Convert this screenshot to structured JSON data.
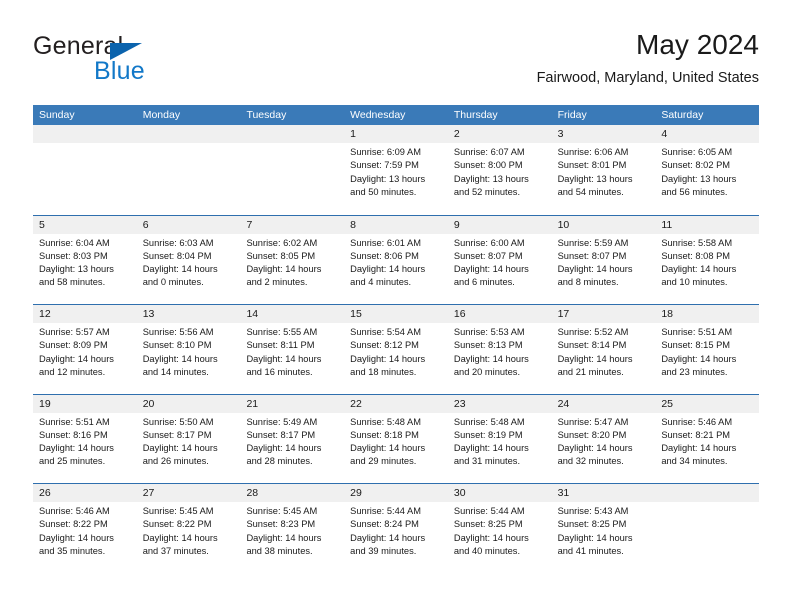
{
  "brand": {
    "word_top": "General",
    "word_bottom": "Blue",
    "triangle_icon": "brand-triangle-icon",
    "color_dark": "#231f20",
    "color_blue": "#1278c8"
  },
  "header": {
    "title": "May 2024",
    "subtitle": "Fairwood, Maryland, United States"
  },
  "theme": {
    "header_blue": "#3a7ab8",
    "row_divider_blue": "#2f6fae",
    "day_band_gray": "#f0f0f0",
    "text": "#1a1a1a"
  },
  "calendar": {
    "weekdays": [
      "Sunday",
      "Monday",
      "Tuesday",
      "Wednesday",
      "Thursday",
      "Friday",
      "Saturday"
    ],
    "weeks": [
      [
        {
          "day": "",
          "sunrise": "",
          "sunset": "",
          "daylight_line1": "",
          "daylight_line2": ""
        },
        {
          "day": "",
          "sunrise": "",
          "sunset": "",
          "daylight_line1": "",
          "daylight_line2": ""
        },
        {
          "day": "",
          "sunrise": "",
          "sunset": "",
          "daylight_line1": "",
          "daylight_line2": ""
        },
        {
          "day": "1",
          "sunrise": "Sunrise: 6:09 AM",
          "sunset": "Sunset: 7:59 PM",
          "daylight_line1": "Daylight: 13 hours",
          "daylight_line2": "and 50 minutes."
        },
        {
          "day": "2",
          "sunrise": "Sunrise: 6:07 AM",
          "sunset": "Sunset: 8:00 PM",
          "daylight_line1": "Daylight: 13 hours",
          "daylight_line2": "and 52 minutes."
        },
        {
          "day": "3",
          "sunrise": "Sunrise: 6:06 AM",
          "sunset": "Sunset: 8:01 PM",
          "daylight_line1": "Daylight: 13 hours",
          "daylight_line2": "and 54 minutes."
        },
        {
          "day": "4",
          "sunrise": "Sunrise: 6:05 AM",
          "sunset": "Sunset: 8:02 PM",
          "daylight_line1": "Daylight: 13 hours",
          "daylight_line2": "and 56 minutes."
        }
      ],
      [
        {
          "day": "5",
          "sunrise": "Sunrise: 6:04 AM",
          "sunset": "Sunset: 8:03 PM",
          "daylight_line1": "Daylight: 13 hours",
          "daylight_line2": "and 58 minutes."
        },
        {
          "day": "6",
          "sunrise": "Sunrise: 6:03 AM",
          "sunset": "Sunset: 8:04 PM",
          "daylight_line1": "Daylight: 14 hours",
          "daylight_line2": "and 0 minutes."
        },
        {
          "day": "7",
          "sunrise": "Sunrise: 6:02 AM",
          "sunset": "Sunset: 8:05 PM",
          "daylight_line1": "Daylight: 14 hours",
          "daylight_line2": "and 2 minutes."
        },
        {
          "day": "8",
          "sunrise": "Sunrise: 6:01 AM",
          "sunset": "Sunset: 8:06 PM",
          "daylight_line1": "Daylight: 14 hours",
          "daylight_line2": "and 4 minutes."
        },
        {
          "day": "9",
          "sunrise": "Sunrise: 6:00 AM",
          "sunset": "Sunset: 8:07 PM",
          "daylight_line1": "Daylight: 14 hours",
          "daylight_line2": "and 6 minutes."
        },
        {
          "day": "10",
          "sunrise": "Sunrise: 5:59 AM",
          "sunset": "Sunset: 8:07 PM",
          "daylight_line1": "Daylight: 14 hours",
          "daylight_line2": "and 8 minutes."
        },
        {
          "day": "11",
          "sunrise": "Sunrise: 5:58 AM",
          "sunset": "Sunset: 8:08 PM",
          "daylight_line1": "Daylight: 14 hours",
          "daylight_line2": "and 10 minutes."
        }
      ],
      [
        {
          "day": "12",
          "sunrise": "Sunrise: 5:57 AM",
          "sunset": "Sunset: 8:09 PM",
          "daylight_line1": "Daylight: 14 hours",
          "daylight_line2": "and 12 minutes."
        },
        {
          "day": "13",
          "sunrise": "Sunrise: 5:56 AM",
          "sunset": "Sunset: 8:10 PM",
          "daylight_line1": "Daylight: 14 hours",
          "daylight_line2": "and 14 minutes."
        },
        {
          "day": "14",
          "sunrise": "Sunrise: 5:55 AM",
          "sunset": "Sunset: 8:11 PM",
          "daylight_line1": "Daylight: 14 hours",
          "daylight_line2": "and 16 minutes."
        },
        {
          "day": "15",
          "sunrise": "Sunrise: 5:54 AM",
          "sunset": "Sunset: 8:12 PM",
          "daylight_line1": "Daylight: 14 hours",
          "daylight_line2": "and 18 minutes."
        },
        {
          "day": "16",
          "sunrise": "Sunrise: 5:53 AM",
          "sunset": "Sunset: 8:13 PM",
          "daylight_line1": "Daylight: 14 hours",
          "daylight_line2": "and 20 minutes."
        },
        {
          "day": "17",
          "sunrise": "Sunrise: 5:52 AM",
          "sunset": "Sunset: 8:14 PM",
          "daylight_line1": "Daylight: 14 hours",
          "daylight_line2": "and 21 minutes."
        },
        {
          "day": "18",
          "sunrise": "Sunrise: 5:51 AM",
          "sunset": "Sunset: 8:15 PM",
          "daylight_line1": "Daylight: 14 hours",
          "daylight_line2": "and 23 minutes."
        }
      ],
      [
        {
          "day": "19",
          "sunrise": "Sunrise: 5:51 AM",
          "sunset": "Sunset: 8:16 PM",
          "daylight_line1": "Daylight: 14 hours",
          "daylight_line2": "and 25 minutes."
        },
        {
          "day": "20",
          "sunrise": "Sunrise: 5:50 AM",
          "sunset": "Sunset: 8:17 PM",
          "daylight_line1": "Daylight: 14 hours",
          "daylight_line2": "and 26 minutes."
        },
        {
          "day": "21",
          "sunrise": "Sunrise: 5:49 AM",
          "sunset": "Sunset: 8:17 PM",
          "daylight_line1": "Daylight: 14 hours",
          "daylight_line2": "and 28 minutes."
        },
        {
          "day": "22",
          "sunrise": "Sunrise: 5:48 AM",
          "sunset": "Sunset: 8:18 PM",
          "daylight_line1": "Daylight: 14 hours",
          "daylight_line2": "and 29 minutes."
        },
        {
          "day": "23",
          "sunrise": "Sunrise: 5:48 AM",
          "sunset": "Sunset: 8:19 PM",
          "daylight_line1": "Daylight: 14 hours",
          "daylight_line2": "and 31 minutes."
        },
        {
          "day": "24",
          "sunrise": "Sunrise: 5:47 AM",
          "sunset": "Sunset: 8:20 PM",
          "daylight_line1": "Daylight: 14 hours",
          "daylight_line2": "and 32 minutes."
        },
        {
          "day": "25",
          "sunrise": "Sunrise: 5:46 AM",
          "sunset": "Sunset: 8:21 PM",
          "daylight_line1": "Daylight: 14 hours",
          "daylight_line2": "and 34 minutes."
        }
      ],
      [
        {
          "day": "26",
          "sunrise": "Sunrise: 5:46 AM",
          "sunset": "Sunset: 8:22 PM",
          "daylight_line1": "Daylight: 14 hours",
          "daylight_line2": "and 35 minutes."
        },
        {
          "day": "27",
          "sunrise": "Sunrise: 5:45 AM",
          "sunset": "Sunset: 8:22 PM",
          "daylight_line1": "Daylight: 14 hours",
          "daylight_line2": "and 37 minutes."
        },
        {
          "day": "28",
          "sunrise": "Sunrise: 5:45 AM",
          "sunset": "Sunset: 8:23 PM",
          "daylight_line1": "Daylight: 14 hours",
          "daylight_line2": "and 38 minutes."
        },
        {
          "day": "29",
          "sunrise": "Sunrise: 5:44 AM",
          "sunset": "Sunset: 8:24 PM",
          "daylight_line1": "Daylight: 14 hours",
          "daylight_line2": "and 39 minutes."
        },
        {
          "day": "30",
          "sunrise": "Sunrise: 5:44 AM",
          "sunset": "Sunset: 8:25 PM",
          "daylight_line1": "Daylight: 14 hours",
          "daylight_line2": "and 40 minutes."
        },
        {
          "day": "31",
          "sunrise": "Sunrise: 5:43 AM",
          "sunset": "Sunset: 8:25 PM",
          "daylight_line1": "Daylight: 14 hours",
          "daylight_line2": "and 41 minutes."
        },
        {
          "day": "",
          "sunrise": "",
          "sunset": "",
          "daylight_line1": "",
          "daylight_line2": ""
        }
      ]
    ]
  }
}
